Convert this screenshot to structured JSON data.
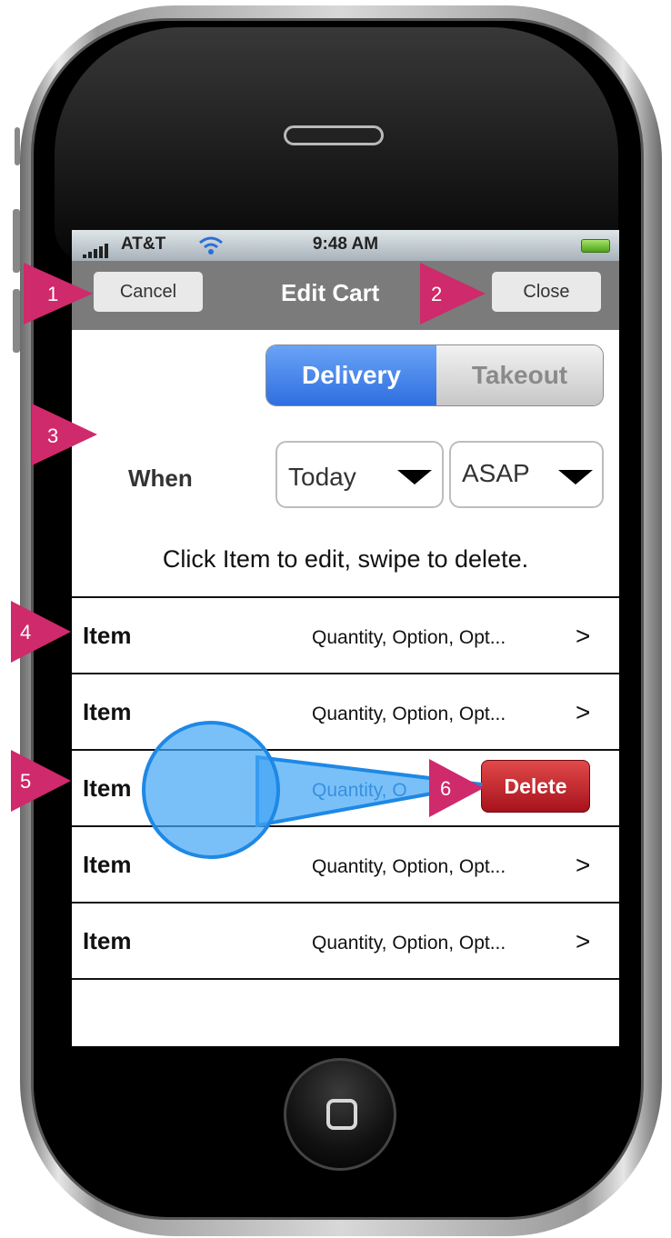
{
  "status_bar": {
    "carrier": "AT&T",
    "time": "9:48 AM"
  },
  "nav_bar": {
    "cancel_label": "Cancel",
    "title": "Edit Cart",
    "close_label": "Close"
  },
  "order_type": {
    "options": [
      "Delivery",
      "Takeout"
    ],
    "selected": "Delivery"
  },
  "when": {
    "label": "When",
    "day_value": "Today",
    "time_value": "ASAP"
  },
  "instruction": "Click Item to edit, swipe to delete.",
  "items": [
    {
      "name": "Item",
      "detail": "Quantity, Option, Opt...",
      "chevron": ">"
    },
    {
      "name": "Item",
      "detail": "Quantity, Option, Opt...",
      "chevron": ">"
    },
    {
      "name": "Item",
      "detail": "Quantity, O",
      "chevron": ">",
      "delete_label": "Delete"
    },
    {
      "name": "Item",
      "detail": "Quantity, Option, Opt...",
      "chevron": ">"
    },
    {
      "name": "Item",
      "detail": "Quantity, Option, Opt...",
      "chevron": ">"
    }
  ],
  "annotations": [
    "1",
    "2",
    "3",
    "4",
    "5",
    "6"
  ],
  "colors": {
    "annotation": "#cf2a6b",
    "nav_bar": "#7b7b7b",
    "segment_active": "#2e6fe0",
    "delete": "#c0181f",
    "swipe_gesture": "#2196f3"
  }
}
